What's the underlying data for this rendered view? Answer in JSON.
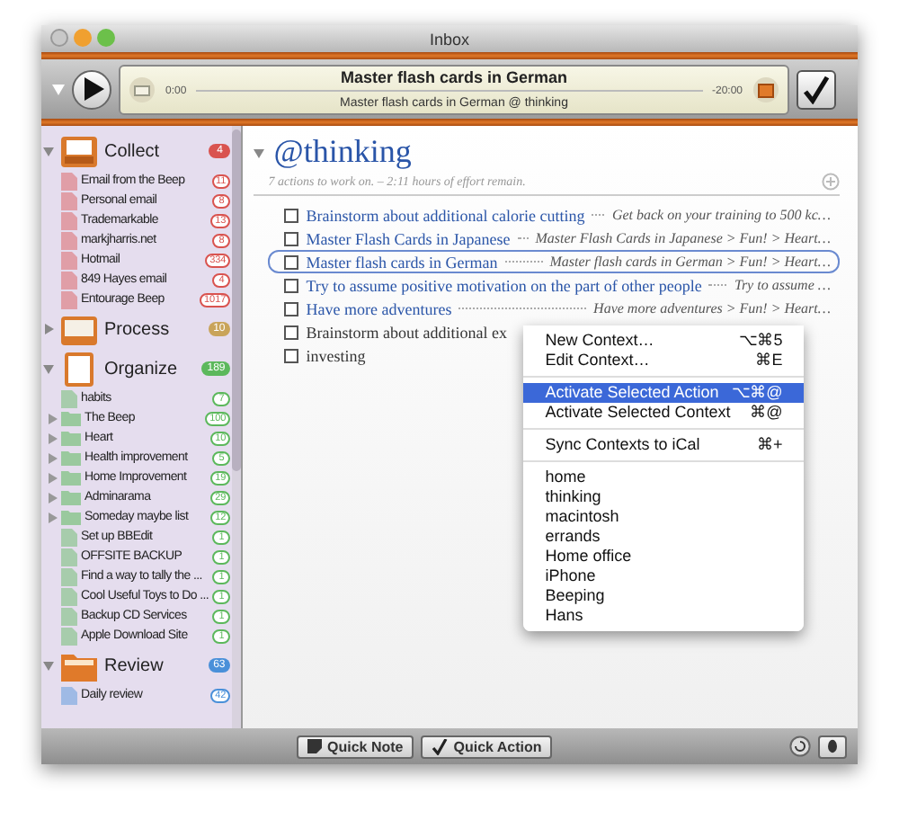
{
  "window": {
    "title": "Inbox"
  },
  "player": {
    "title": "Master flash cards in German",
    "subtitle": "Master flash cards in German @ thinking",
    "elapsed": "0:00",
    "remaining": "-20:00"
  },
  "sidebar": {
    "groups": [
      {
        "name": "Collect",
        "badge": "4",
        "color": "#d9534f",
        "expanded": true,
        "items": [
          {
            "name": "Email from the Beep",
            "badge": "11",
            "kind": "list"
          },
          {
            "name": "Personal email",
            "badge": "8",
            "kind": "list"
          },
          {
            "name": "Trademarkable",
            "badge": "13",
            "kind": "list"
          },
          {
            "name": "markjharris.net",
            "badge": "8",
            "kind": "list"
          },
          {
            "name": "Hotmail",
            "badge": "334",
            "kind": "list"
          },
          {
            "name": "849 Hayes email",
            "badge": "4",
            "kind": "list"
          },
          {
            "name": "Entourage Beep",
            "badge": "1017",
            "kind": "list"
          }
        ]
      },
      {
        "name": "Process",
        "badge": "10",
        "color": "#c9a45a",
        "expanded": false
      },
      {
        "name": "Organize",
        "badge": "189",
        "color": "#5cb85c",
        "expanded": true,
        "items": [
          {
            "name": "habits",
            "badge": "7",
            "kind": "list"
          },
          {
            "name": "The Beep",
            "badge": "100",
            "kind": "folder"
          },
          {
            "name": "Heart",
            "badge": "10",
            "kind": "folder"
          },
          {
            "name": "Health improvement",
            "badge": "5",
            "kind": "folder"
          },
          {
            "name": "Home Improvement",
            "badge": "19",
            "kind": "folder"
          },
          {
            "name": "Adminarama",
            "badge": "29",
            "kind": "folder"
          },
          {
            "name": "Someday maybe list",
            "badge": "12",
            "kind": "folder"
          },
          {
            "name": "Set up BBEdit",
            "badge": "1",
            "kind": "list"
          },
          {
            "name": "OFFSITE BACKUP",
            "badge": "1",
            "kind": "list"
          },
          {
            "name": "Find a way to tally the ...",
            "badge": "1",
            "kind": "list"
          },
          {
            "name": "Cool Useful Toys to Do ...",
            "badge": "1",
            "kind": "list"
          },
          {
            "name": "Backup CD Services",
            "badge": "1",
            "kind": "list"
          },
          {
            "name": "Apple Download Site",
            "badge": "1",
            "kind": "list"
          }
        ]
      },
      {
        "name": "Review",
        "badge": "63",
        "color": "#4a90d9",
        "expanded": true,
        "items": [
          {
            "name": "Daily review",
            "badge": "42",
            "kind": "list"
          }
        ]
      }
    ]
  },
  "context": {
    "symbol": "@",
    "name": "thinking",
    "summary": "7 actions to work on. – 2:11 hours of effort remain.",
    "actions": [
      {
        "title": "Brainstorm about additional calorie cutting",
        "detail": "Get back on your training to 500 kc…",
        "checked": false,
        "selected": false,
        "color": "#2a55a8"
      },
      {
        "title": "Master Flash Cards in Japanese",
        "detail": "Master Flash Cards in Japanese > Fun! > Heart…",
        "checked": false,
        "selected": false,
        "color": "#2a55a8"
      },
      {
        "title": "Master flash cards in German",
        "detail": "Master flash cards in German > Fun! > Heart…",
        "checked": false,
        "selected": true,
        "color": "#2a55a8"
      },
      {
        "title": "Try to assume positive motivation on the part of other people",
        "detail": "Try to assume …",
        "checked": false,
        "selected": false,
        "color": "#2a55a8"
      },
      {
        "title": "Have more adventures",
        "detail": "Have more adventures > Fun! > Heart…",
        "checked": false,
        "selected": false,
        "color": "#2a55a8"
      },
      {
        "title": "Brainstorm about additional ex",
        "checked": false,
        "selected": false,
        "color": "#333333"
      },
      {
        "title": "investing",
        "checked": false,
        "selected": false,
        "color": "#333333"
      }
    ]
  },
  "menu": {
    "sections": [
      [
        {
          "label": "New Context…",
          "shortcut": "⌥⌘5",
          "selected": false
        },
        {
          "label": "Edit Context…",
          "shortcut": "⌘E",
          "selected": false
        }
      ],
      [
        {
          "label": "Activate Selected Action",
          "shortcut": "⌥⌘@",
          "selected": true
        },
        {
          "label": "Activate Selected Context",
          "shortcut": "⌘@",
          "selected": false
        }
      ],
      [
        {
          "label": "Sync Contexts to iCal",
          "shortcut": "⌘+",
          "selected": false
        }
      ],
      [
        {
          "label": "home",
          "selected": false
        },
        {
          "label": "thinking",
          "selected": false
        },
        {
          "label": "macintosh",
          "selected": false
        },
        {
          "label": "errands",
          "selected": false
        },
        {
          "label": "Home office",
          "selected": false
        },
        {
          "label": "iPhone",
          "selected": false
        },
        {
          "label": "Beeping",
          "selected": false
        },
        {
          "label": "Hans",
          "selected": false
        }
      ]
    ]
  },
  "bottom_bar": {
    "buttons": [
      {
        "label": "Quick Note"
      },
      {
        "label": "Quick Action"
      }
    ]
  }
}
